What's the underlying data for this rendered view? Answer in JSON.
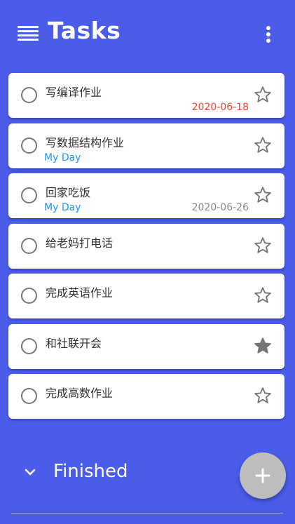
{
  "header": {
    "title": "Tasks",
    "menu_icon": "menu-icon",
    "more_icon": "more-vertical-icon"
  },
  "tasks": [
    {
      "title": "写编译作业",
      "my_day": "",
      "date": "2020-06-18",
      "date_overdue": true,
      "starred": false
    },
    {
      "title": "写数据结构作业",
      "my_day": "My Day",
      "date": "",
      "date_overdue": false,
      "starred": false
    },
    {
      "title": "回家吃饭",
      "my_day": "My Day",
      "date": "2020-06-26",
      "date_overdue": false,
      "starred": false
    },
    {
      "title": "给老妈打电话",
      "my_day": "",
      "date": "",
      "date_overdue": false,
      "starred": false
    },
    {
      "title": "完成英语作业",
      "my_day": "",
      "date": "",
      "date_overdue": false,
      "starred": false
    },
    {
      "title": "和社联开会",
      "my_day": "",
      "date": "",
      "date_overdue": false,
      "starred": true
    },
    {
      "title": "完成高数作业",
      "my_day": "",
      "date": "",
      "date_overdue": false,
      "starred": false
    }
  ],
  "finished_section": {
    "label": "Finished",
    "expand_icon": "chevron-down-icon"
  },
  "fab": {
    "icon": "plus-icon"
  },
  "colors": {
    "background": "#4a5ce8",
    "my_day": "#2196f3",
    "overdue_date": "#f44336",
    "star_filled": "#757575"
  }
}
